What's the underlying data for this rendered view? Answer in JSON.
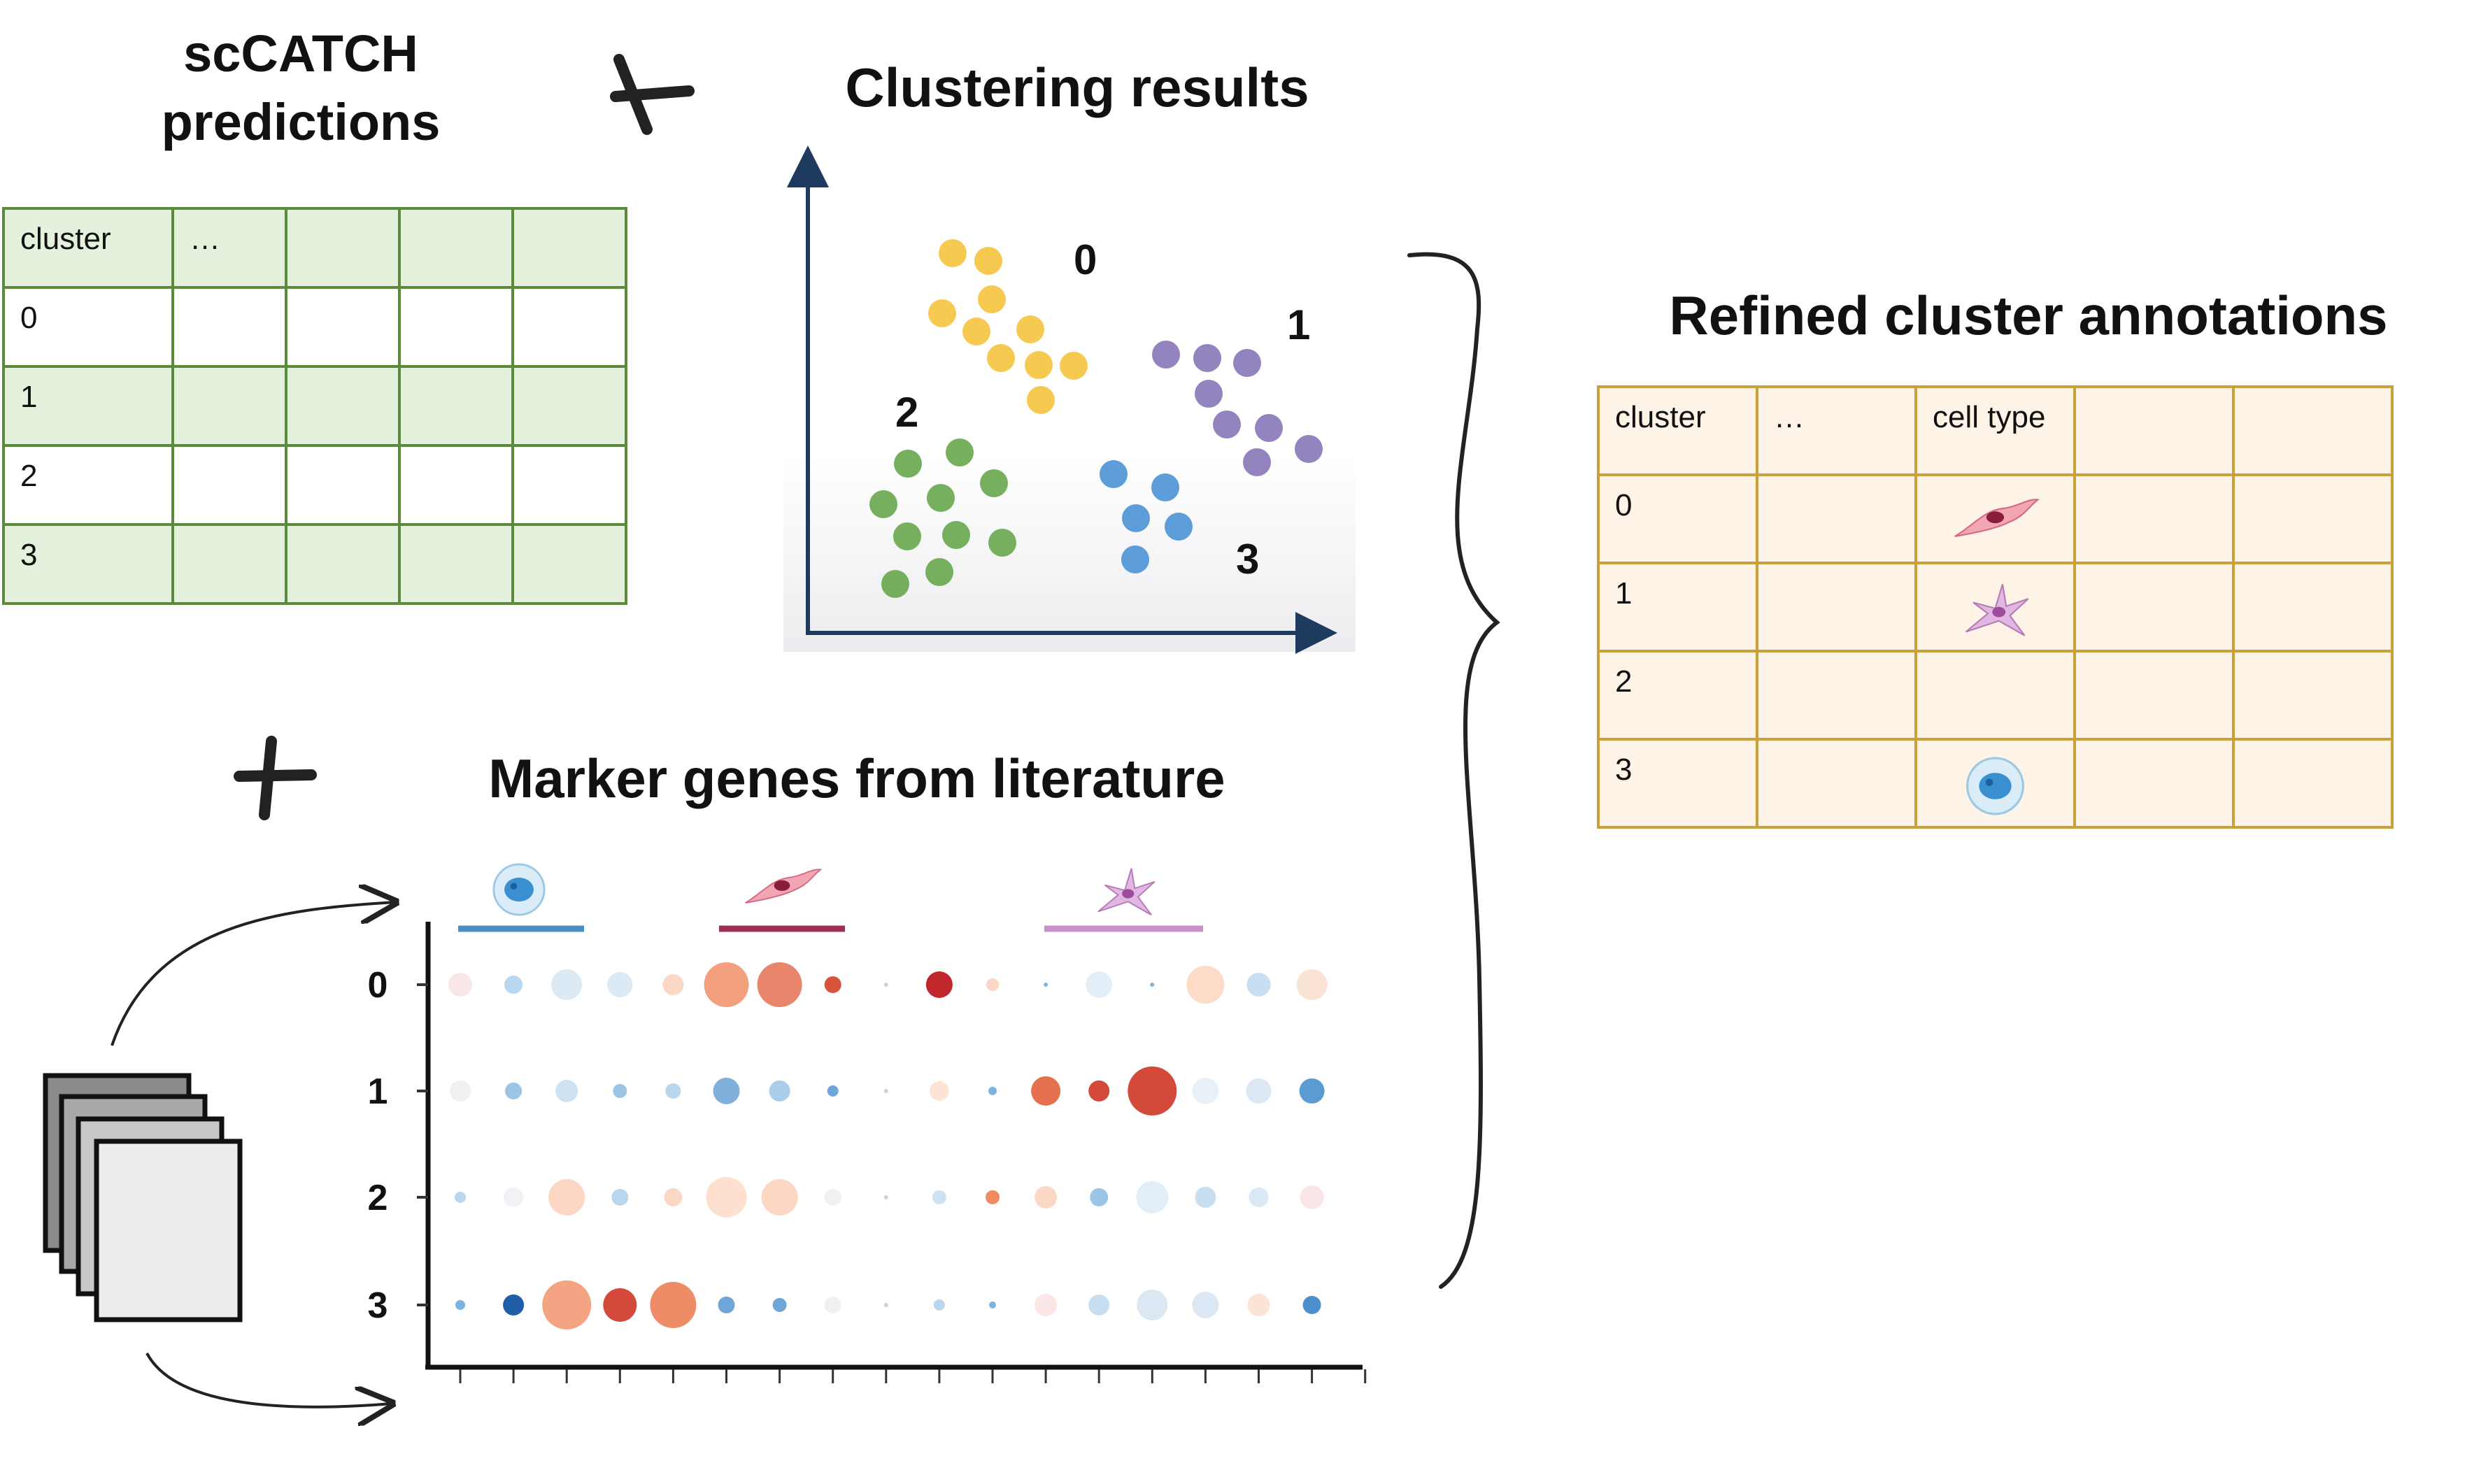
{
  "colors": {
    "green_fill": "#e4f1dc",
    "green_border": "#5a8a3a",
    "orange_fill": "#fdf4e7",
    "orange_border": "#c9a03a",
    "yellow": "#f5c542",
    "purple": "#8a78b8",
    "green_dot": "#6aa84f",
    "blue_dot": "#4f95d6",
    "axis": "#1f3a5f",
    "bar_blue": "#4a90c0",
    "bar_red": "#a03050",
    "bar_pink": "#c890c8"
  },
  "sections": {
    "sccatch_title_line1": "scCATCH",
    "sccatch_title_line2": "predictions",
    "clustering_title": "Clustering results",
    "markers_title": "Marker genes from literature",
    "refined_title": "Refined cluster annotations"
  },
  "sccatch_table": {
    "header": [
      "cluster",
      "…",
      "",
      "",
      ""
    ],
    "rows": [
      [
        "0",
        "",
        "",
        "",
        ""
      ],
      [
        "1",
        "",
        "",
        "",
        ""
      ],
      [
        "2",
        "",
        "",
        "",
        ""
      ],
      [
        "3",
        "",
        "",
        "",
        ""
      ]
    ]
  },
  "refined_table": {
    "header": [
      "cluster",
      "…",
      "cell type",
      "",
      ""
    ],
    "rows": [
      [
        "0",
        "",
        "",
        "",
        ""
      ],
      [
        "1",
        "",
        "",
        "",
        ""
      ],
      [
        "2",
        "",
        "",
        "",
        ""
      ],
      [
        "3",
        "",
        "",
        "",
        ""
      ]
    ],
    "cell_type_icons": [
      "fibroblast-icon",
      "neuron-icon",
      "",
      "immune-cell-icon"
    ]
  },
  "clusters": [
    {
      "label": "0",
      "color": "yellow"
    },
    {
      "label": "1",
      "color": "purple"
    },
    {
      "label": "2",
      "color": "green_dot"
    },
    {
      "label": "3",
      "color": "blue_dot"
    }
  ],
  "dotplot": {
    "row_labels": [
      "0",
      "1",
      "2",
      "3"
    ],
    "group_icons": [
      "immune-cell-icon",
      "fibroblast-icon",
      "neuron-icon"
    ]
  }
}
